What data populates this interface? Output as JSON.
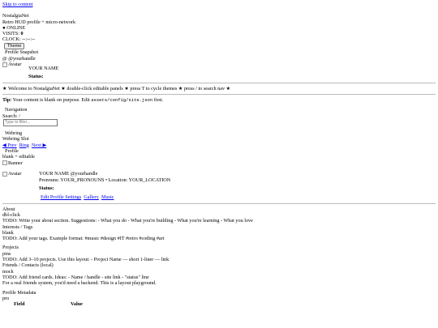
{
  "skip_link": "Skip to content",
  "brand": {
    "name": "NostalgiaNet",
    "tagline": "Retro HUD profile + micro-network"
  },
  "status": {
    "online": "● ONLINE",
    "visits_label": "VISITS: ",
    "visits_value": "0",
    "clock_label": "CLOCK: ",
    "clock_value": "--:--:--"
  },
  "theme_button": "Theme",
  "snapshot": {
    "title": "Profile Snapshot",
    "handle": "@ @yourhandle",
    "avatar_alt": "Avatar",
    "name": "YOUR NAME",
    "status_label": "Status:"
  },
  "marquee": "★ Welcome to NostalgiaNet ★ double-click editable panels ★ press T to cycle themes ★ press / to search nav ★",
  "tip": {
    "label": "Tip:",
    "text_before": " Your content is blank on purpose. Edit ",
    "code": "assets/config/site.json",
    "text_after": " first."
  },
  "navigation": {
    "title": "Navigation",
    "search_label": "Search: /",
    "filter_placeholder": "Type to filter..."
  },
  "webring": {
    "title": "Webring",
    "slot": "Webring Slot",
    "prev": "◀ Prev",
    "ring": "Ring",
    "next": "Next ▶"
  },
  "profile": {
    "title": "Profile",
    "mode": "blank + editable",
    "banner_alt": "Banner",
    "avatar_alt": "Avatar",
    "name_handle": "YOUR NAME @yourhandle",
    "pronouns_location": "Pronouns: YOUR_PRONOUNS • Location: YOUR_LOCATION",
    "status_label": "Status:",
    "links": [
      "Edit Profile Settings",
      "Gallery",
      "Music"
    ]
  },
  "sections": {
    "about": {
      "title": "About",
      "mode": "dbl-click",
      "body": "TODO: Write your about section. Suggestions: - What you do - What you're building - What you're learning - What you love"
    },
    "interests": {
      "title": "Interests / Tags",
      "mode": "blank",
      "body": "TODO: Add your tags. Example format: #music #design #IT #retro #coding #art"
    },
    "projects": {
      "title": "Projects",
      "mode": "pins",
      "body": "TODO: Add 3–10 projects. Use this layout: - Project Name — short 1-liner — link"
    },
    "friends": {
      "title": "Friends / Contacts (local)",
      "mode": "mock",
      "body": "TODO: Add friend cards. Ideas: - Name / handle - site link - \"status\" line",
      "note": "For a real friends system, you'd need a backend. This is a layout playground."
    },
    "metadata": {
      "title": "Profile Metadata",
      "mode": "pro",
      "col_field": "Field",
      "col_value": "Value"
    }
  }
}
